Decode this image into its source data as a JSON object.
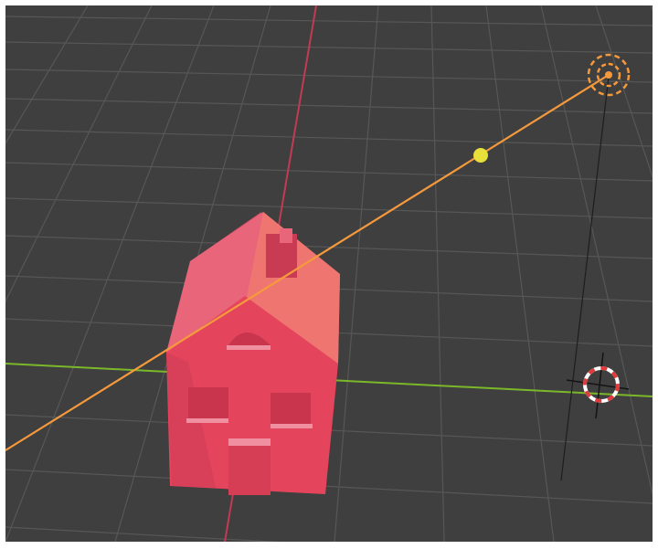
{
  "app": {
    "name": "3D Viewport",
    "view": "perspective"
  },
  "scene": {
    "objects": [
      {
        "name": "house",
        "type": "mesh",
        "color": "#e8526a"
      },
      {
        "name": "light",
        "type": "spot light",
        "color": "#f59a3c"
      },
      {
        "name": "light-target",
        "type": "target handle",
        "color": "#e7df3a"
      },
      {
        "name": "3d-cursor",
        "type": "cursor",
        "colors": [
          "#e84a4a",
          "#ffffff"
        ]
      }
    ],
    "axes": {
      "x_color": "#7ab82a",
      "y_color": "#c23b55"
    },
    "grid_color": "#555555",
    "background": "#3f3f3f"
  }
}
